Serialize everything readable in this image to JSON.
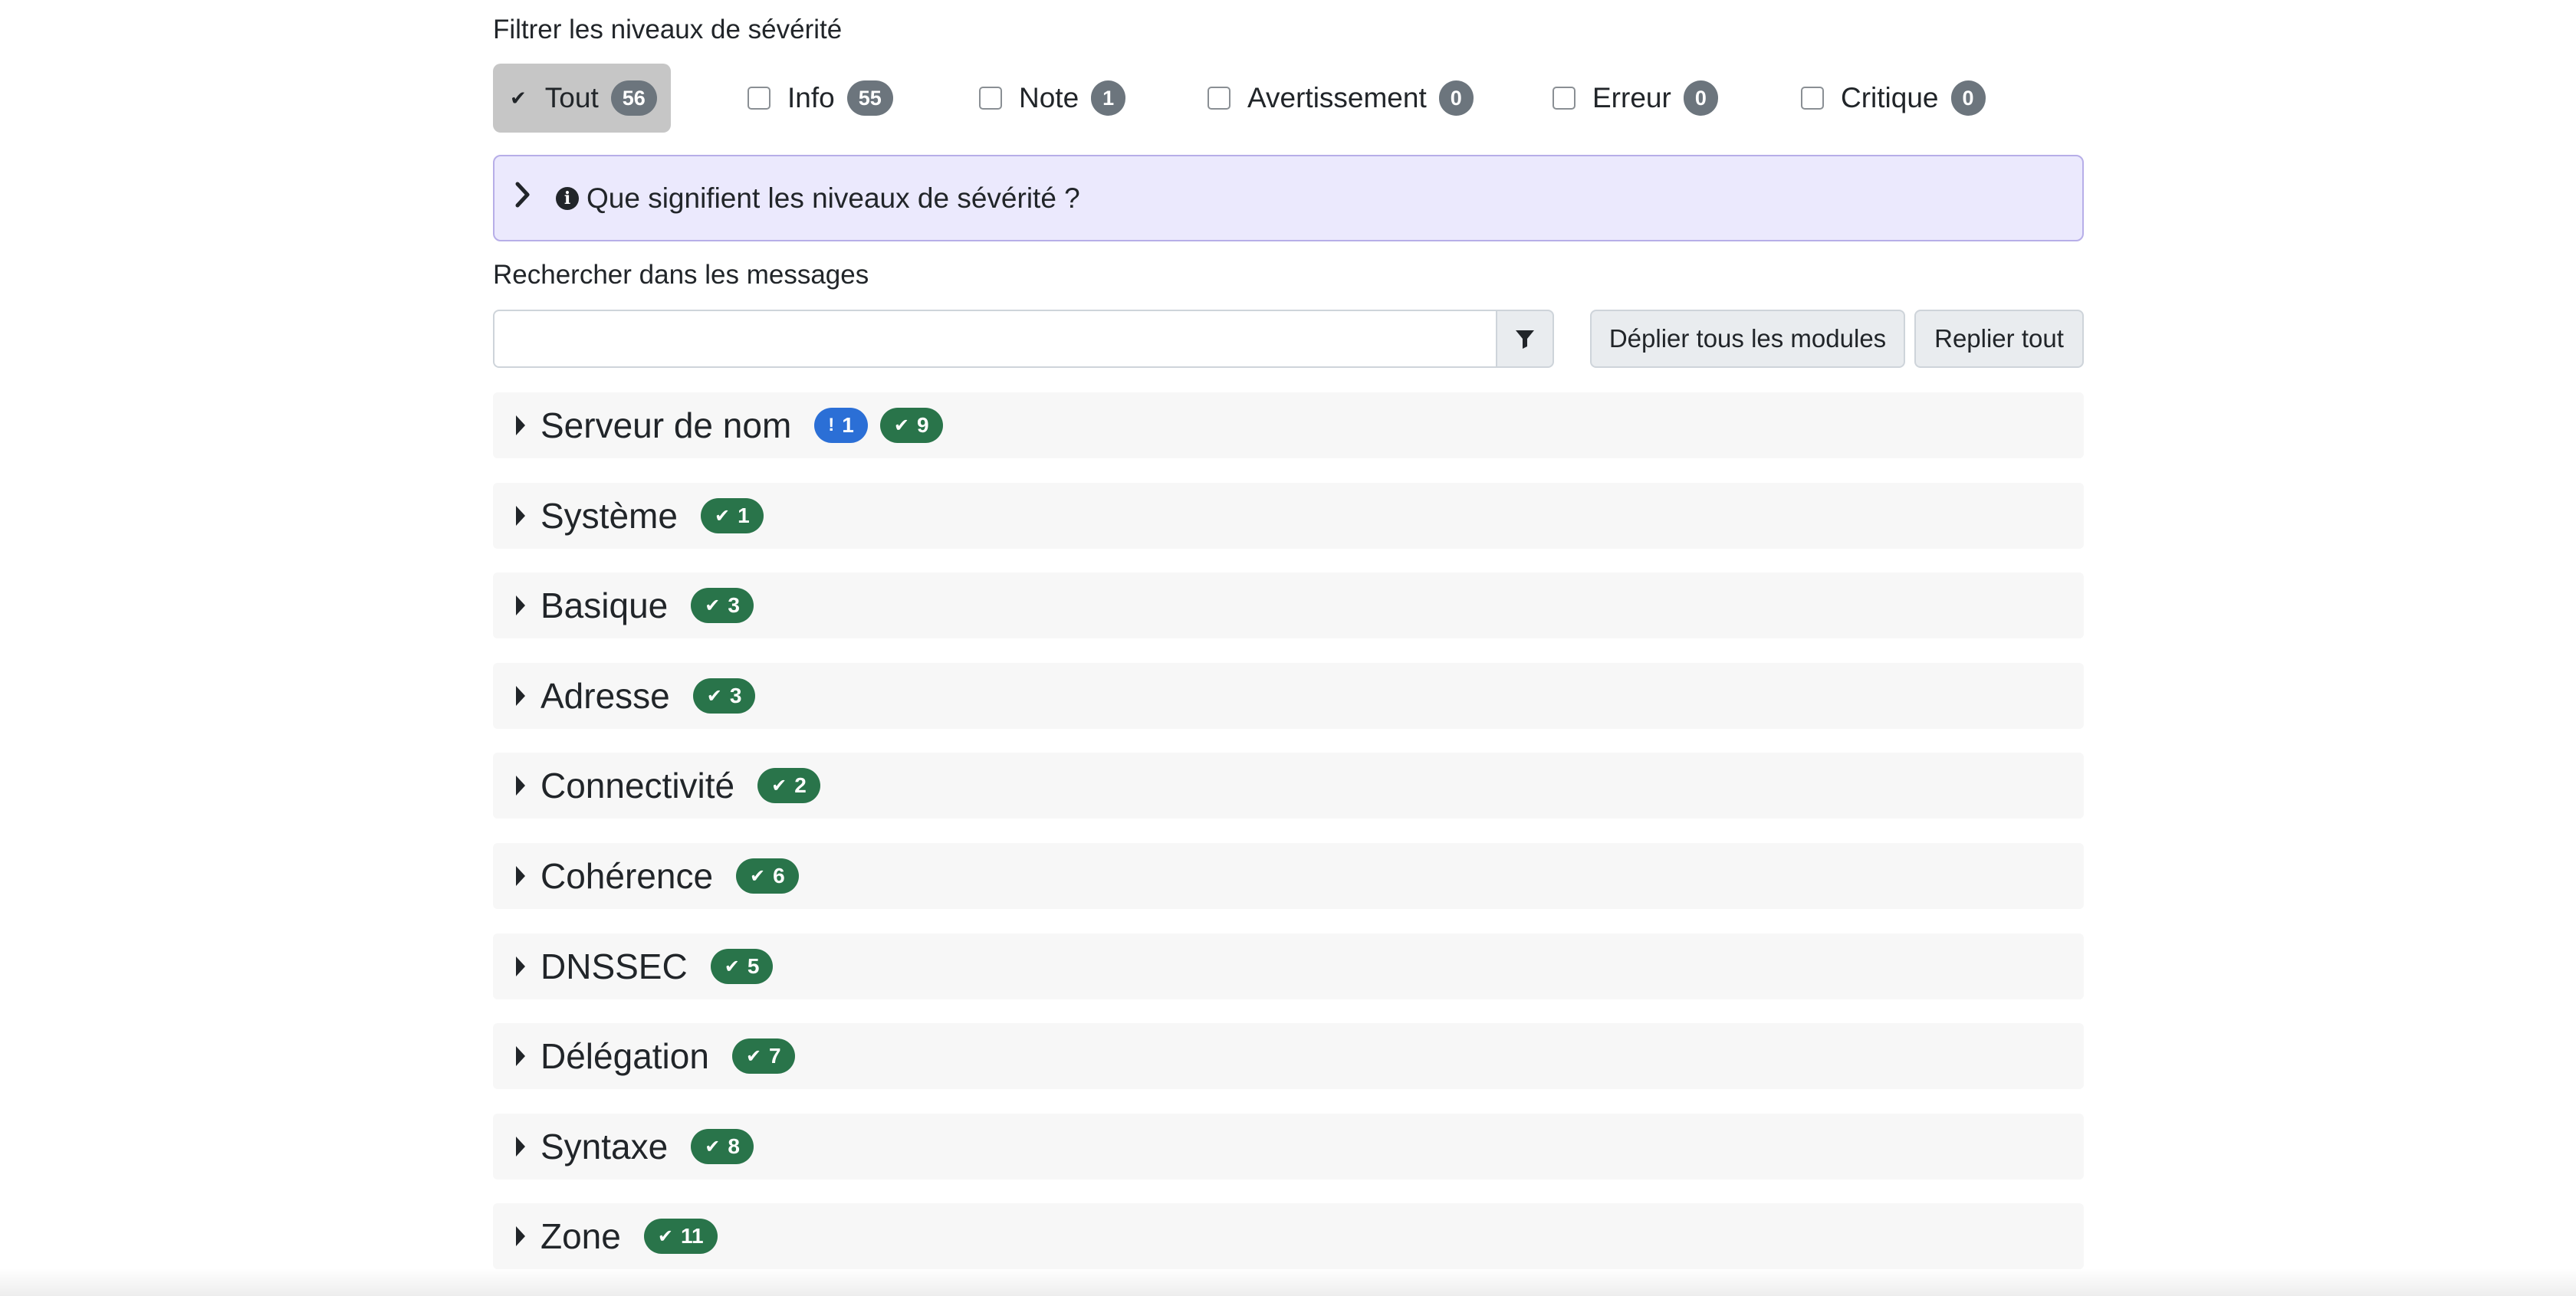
{
  "filter": {
    "title": "Filtrer les niveaux de sévérité",
    "items": [
      {
        "label": "Tout",
        "count": "56",
        "checked": true
      },
      {
        "label": "Info",
        "count": "55",
        "checked": false
      },
      {
        "label": "Note",
        "count": "1",
        "checked": false
      },
      {
        "label": "Avertissement",
        "count": "0",
        "checked": false
      },
      {
        "label": "Erreur",
        "count": "0",
        "checked": false
      },
      {
        "label": "Critique",
        "count": "0",
        "checked": false
      }
    ]
  },
  "info_box": {
    "text": "Que signifient les niveaux de sévérité ?",
    "bg_color": "#ebe9fd"
  },
  "search": {
    "label": "Rechercher dans les messages",
    "value": "",
    "placeholder": ""
  },
  "actions": {
    "expand_all": "Déplier tous les modules",
    "collapse_all": "Replier tout"
  },
  "modules": [
    {
      "name": "Serveur de nom",
      "warn": "1",
      "ok": "9"
    },
    {
      "name": "Système",
      "ok": "1"
    },
    {
      "name": "Basique",
      "ok": "3"
    },
    {
      "name": "Adresse",
      "ok": "3"
    },
    {
      "name": "Connectivité",
      "ok": "2"
    },
    {
      "name": "Cohérence",
      "ok": "6"
    },
    {
      "name": "DNSSEC",
      "ok": "5"
    },
    {
      "name": "Délégation",
      "ok": "7"
    },
    {
      "name": "Syntaxe",
      "ok": "8"
    },
    {
      "name": "Zone",
      "ok": "11"
    }
  ],
  "colors": {
    "ok_badge": "#29744a",
    "warn_badge": "#2b6fd6",
    "count_badge": "#6c757d"
  },
  "icons": {
    "check": "check-icon",
    "exclamation": "exclamation-icon",
    "filter": "filter-icon",
    "info": "info-circle-icon",
    "chevron": "chevron-right-icon",
    "caret": "caret-right-icon"
  }
}
